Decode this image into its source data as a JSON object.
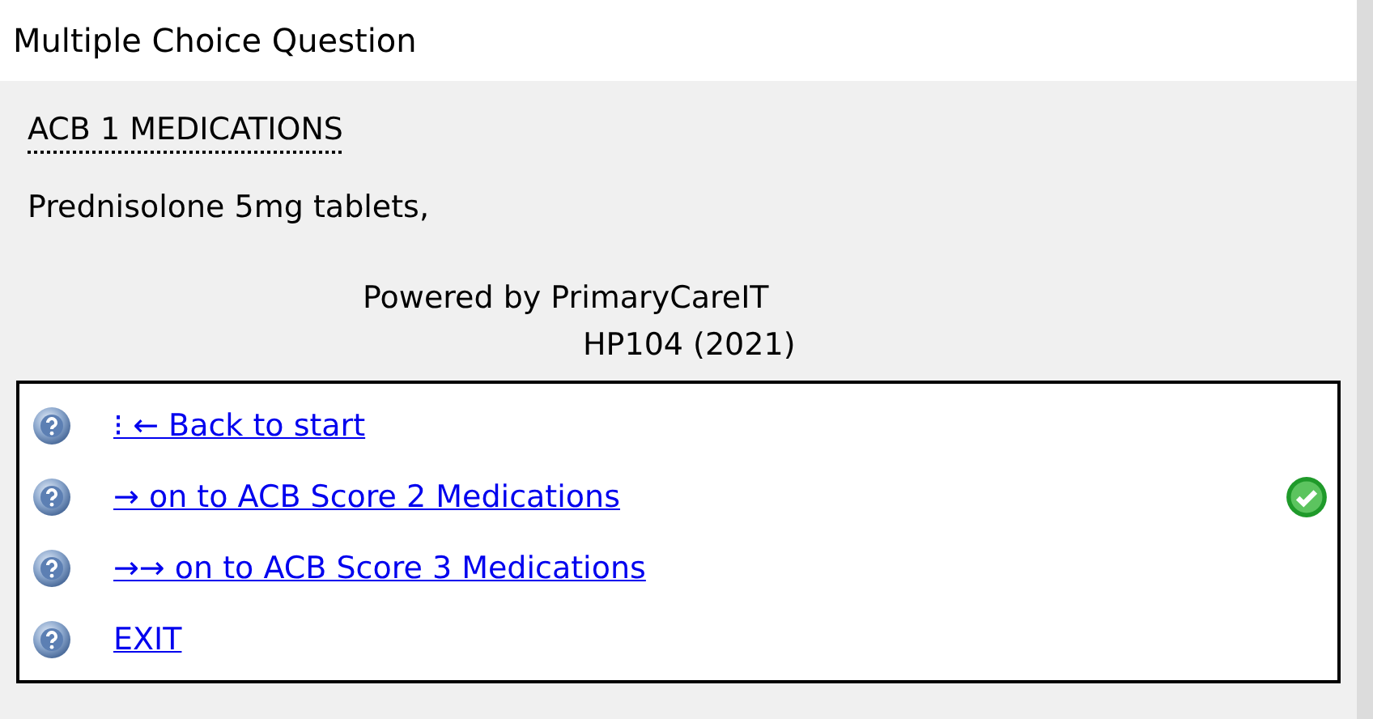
{
  "window": {
    "title": "Multiple Choice Question"
  },
  "heading": "ACB 1 MEDICATIONS",
  "question": "Prednisolone 5mg tablets,",
  "credits": [
    "Powered by PrimaryCareIT",
    "HP104 (2021)"
  ],
  "options": [
    {
      "label": "⁝ ← Back to start",
      "selected": false
    },
    {
      "label": "→ on to ACB Score 2 Medications",
      "selected": true
    },
    {
      "label": "→→ on to ACB Score 3 Medications",
      "selected": false
    },
    {
      "label": "EXIT",
      "selected": false
    }
  ]
}
